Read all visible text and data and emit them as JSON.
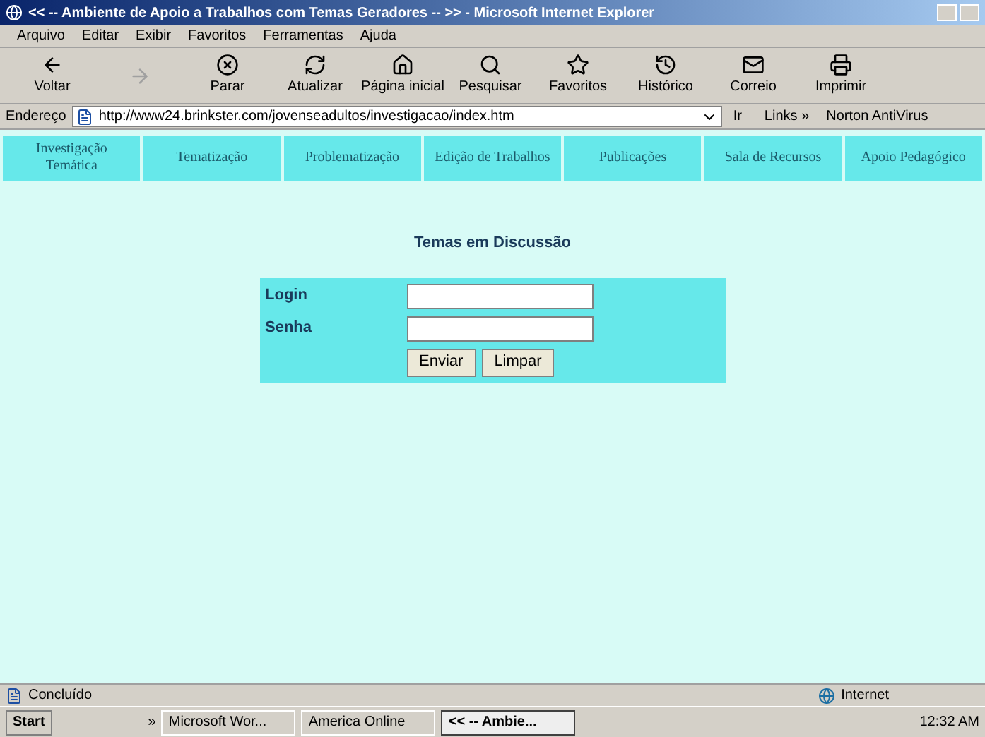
{
  "window": {
    "title": "<< -- Ambiente de Apoio a Trabalhos com Temas Geradores -- >> - Microsoft Internet Explorer"
  },
  "menu": [
    "Arquivo",
    "Editar",
    "Exibir",
    "Favoritos",
    "Ferramentas",
    "Ajuda"
  ],
  "toolbar": [
    {
      "label": "Voltar",
      "kind": "back",
      "disabled": false
    },
    {
      "kind": "forward",
      "disabled": true
    },
    {
      "label": "Parar",
      "kind": "stop",
      "disabled": false
    },
    {
      "label": "Atualizar",
      "kind": "refresh",
      "disabled": false
    },
    {
      "label": "Página inicial",
      "kind": "home",
      "disabled": false
    },
    {
      "label": "Pesquisar",
      "kind": "search",
      "disabled": false
    },
    {
      "label": "Favoritos",
      "kind": "favorites",
      "disabled": false
    },
    {
      "label": "Histórico",
      "kind": "history",
      "disabled": false
    },
    {
      "label": "Correio",
      "kind": "mail",
      "disabled": false
    },
    {
      "label": "Imprimir",
      "kind": "print",
      "disabled": false
    }
  ],
  "address": {
    "label": "Endereço",
    "value": "http://www24.brinkster.com/jovenseadultos/investigacao/index.htm",
    "go": "Ir",
    "links": "Links",
    "links_more": "»",
    "norton": "Norton AntiVirus"
  },
  "nav": [
    "Investigação Temática",
    "Tematização",
    "Problematização",
    "Edição de Trabalhos",
    "Publicações",
    "Sala de Recursos",
    "Apoio Pedagógico"
  ],
  "heading": "Temas em Discussão",
  "form": {
    "fields": [
      {
        "label": "Login"
      },
      {
        "label": "Senha"
      }
    ],
    "buttons": [
      "Enviar",
      "Limpar"
    ]
  },
  "status": {
    "text": "Concluído",
    "zone": "Internet"
  },
  "taskbar": {
    "start": "Start",
    "more": "»",
    "tasks": [
      {
        "label": "Microsoft Wor...",
        "selected": false
      },
      {
        "label": "America Online",
        "selected": false
      },
      {
        "label": "<< -- Ambie...",
        "selected": true
      }
    ],
    "clock": "12:32 AM"
  }
}
